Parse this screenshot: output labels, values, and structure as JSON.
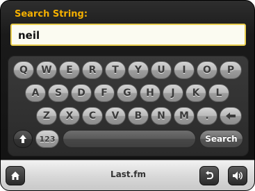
{
  "header": {
    "title": "Search String:"
  },
  "input": {
    "value": "neil"
  },
  "keyboard": {
    "row1": [
      "Q",
      "W",
      "E",
      "R",
      "T",
      "Y",
      "U",
      "I",
      "O",
      "P"
    ],
    "row2": [
      "A",
      "S",
      "D",
      "F",
      "G",
      "H",
      "J",
      "K",
      "L"
    ],
    "row3": [
      "Z",
      "X",
      "C",
      "V",
      "B",
      "N",
      "M",
      "."
    ],
    "numbers_label": "123",
    "search_label": "Search",
    "icons": {
      "backspace": "left-arrow-icon",
      "shift": "up-arrow-icon"
    }
  },
  "bottom_bar": {
    "label": "Last.fm",
    "icons": [
      "home-icon",
      "back-icon",
      "volume-icon"
    ]
  },
  "colors": {
    "title": "#f5b000",
    "input_border": "#e9ce4e",
    "input_bg": "#fbfbf1"
  }
}
